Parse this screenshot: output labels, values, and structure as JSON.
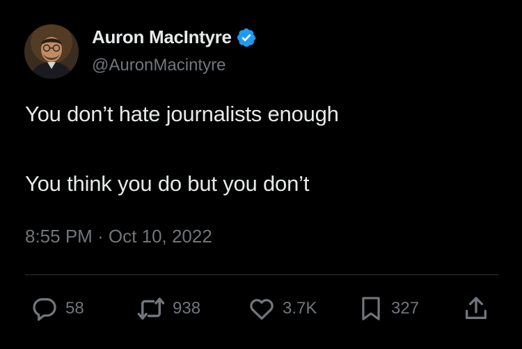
{
  "author": {
    "display_name": "Auron MacIntyre",
    "handle": "@AuronMacintyre",
    "verified": true
  },
  "tweet": {
    "lines": [
      "You don’t hate journalists enough",
      "You think you do but you don’t"
    ],
    "timestamp": "8:55 PM · Oct 10, 2022"
  },
  "actions": {
    "reply": {
      "icon": "reply-icon",
      "count": "58"
    },
    "retweet": {
      "icon": "retweet-icon",
      "count": "938"
    },
    "like": {
      "icon": "heart-icon",
      "count": "3.7K"
    },
    "bookmark": {
      "icon": "bookmark-icon",
      "count": "327"
    },
    "share": {
      "icon": "share-icon"
    }
  },
  "colors": {
    "background": "#000000",
    "primary_text": "#e7e9ea",
    "secondary_text": "#71767b",
    "verified_badge": "#1d9bf0",
    "divider": "#2f3336"
  }
}
